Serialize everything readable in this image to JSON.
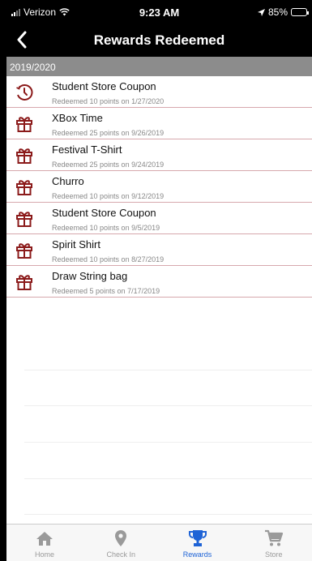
{
  "status": {
    "carrier": "Verizon",
    "time": "9:23 AM",
    "battery": "85%",
    "battery_level": 0.85
  },
  "nav": {
    "title": "Rewards Redeemed"
  },
  "section": {
    "label": "2019/2020"
  },
  "items": [
    {
      "title": "Student Store Coupon",
      "subtitle": "Redeemed 10 points on 1/27/2020",
      "icon": "clock-icon"
    },
    {
      "title": "XBox Time",
      "subtitle": "Redeemed 25 points on 9/26/2019",
      "icon": "gift-icon"
    },
    {
      "title": "Festival T-Shirt",
      "subtitle": "Redeemed 25 points on 9/24/2019",
      "icon": "gift-icon"
    },
    {
      "title": "Churro",
      "subtitle": "Redeemed 10 points on 9/12/2019",
      "icon": "gift-icon"
    },
    {
      "title": "Student Store Coupon",
      "subtitle": "Redeemed 10 points on 9/5/2019",
      "icon": "gift-icon"
    },
    {
      "title": "Spirit Shirt",
      "subtitle": "Redeemed 10 points on 8/27/2019",
      "icon": "gift-icon"
    },
    {
      "title": "Draw String bag",
      "subtitle": "Redeemed 5 points on 7/17/2019",
      "icon": "gift-icon"
    }
  ],
  "tabs": [
    {
      "label": "Home",
      "icon": "home-icon"
    },
    {
      "label": "Check In",
      "icon": "map-pin-icon"
    },
    {
      "label": "Rewards",
      "icon": "trophy-icon",
      "active": true
    },
    {
      "label": "Store",
      "icon": "cart-icon"
    }
  ],
  "colors": {
    "accent": "#1e63d6",
    "icon_red": "#8b1a1a",
    "row_border": "#d7a8ad",
    "section_bg": "#8c8c8c"
  }
}
